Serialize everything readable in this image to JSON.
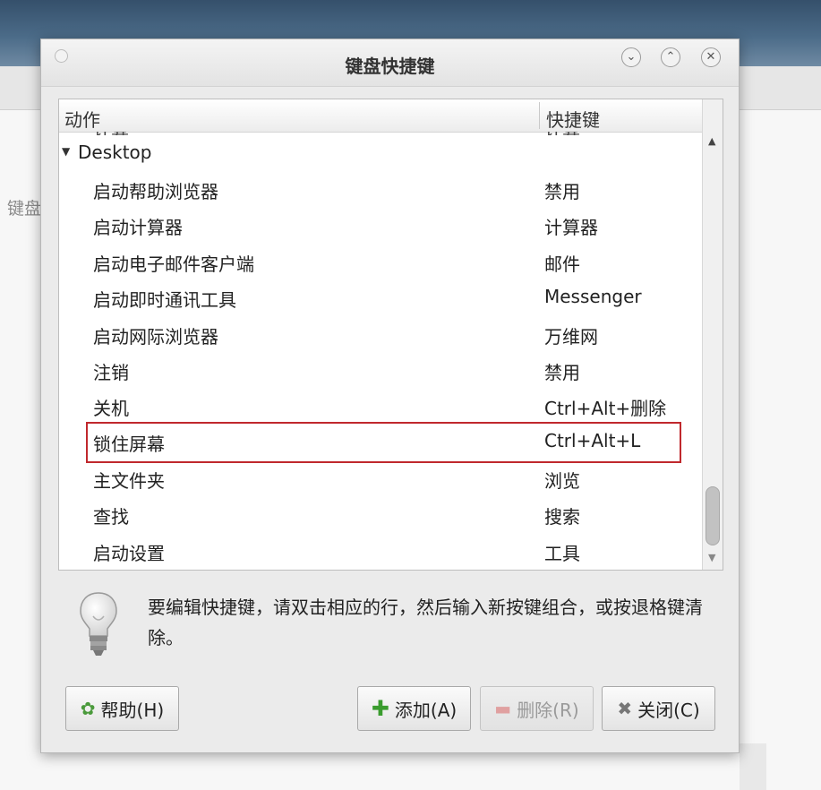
{
  "background": {
    "window_label": "键盘"
  },
  "dialog": {
    "title": "键盘快捷键",
    "window_buttons": [
      "minimize-icon",
      "maximize-icon",
      "close-icon"
    ],
    "list": {
      "columns": {
        "action": "动作",
        "shortcut": "快捷键"
      },
      "cut_row": {
        "action": "计算",
        "shortcut": "计算"
      },
      "group": {
        "label": "Desktop",
        "expanded": true
      },
      "rows": [
        {
          "action": "启动帮助浏览器",
          "shortcut": "禁用"
        },
        {
          "action": "启动计算器",
          "shortcut": "计算器"
        },
        {
          "action": "启动电子邮件客户端",
          "shortcut": "邮件"
        },
        {
          "action": "启动即时通讯工具",
          "shortcut": "Messenger"
        },
        {
          "action": "启动网际浏览器",
          "shortcut": "万维网"
        },
        {
          "action": "注销",
          "shortcut": "禁用"
        },
        {
          "action": "关机",
          "shortcut": "Ctrl+Alt+删除"
        },
        {
          "action": "锁住屏幕",
          "shortcut": "Ctrl+Alt+L"
        },
        {
          "action": "主文件夹",
          "shortcut": "浏览"
        },
        {
          "action": "查找",
          "shortcut": "搜索"
        },
        {
          "action": "启动设置",
          "shortcut": "工具"
        }
      ],
      "highlighted_row": "锁住屏幕",
      "highlight_color": "#c0282d"
    },
    "hint": "要编辑快捷键，请双击相应的行，然后输入新按键组合，或按退格键清除。",
    "buttons": {
      "help": "帮助(H)",
      "add": "添加(A)",
      "remove": "删除(R)",
      "close": "关闭(C)"
    }
  }
}
